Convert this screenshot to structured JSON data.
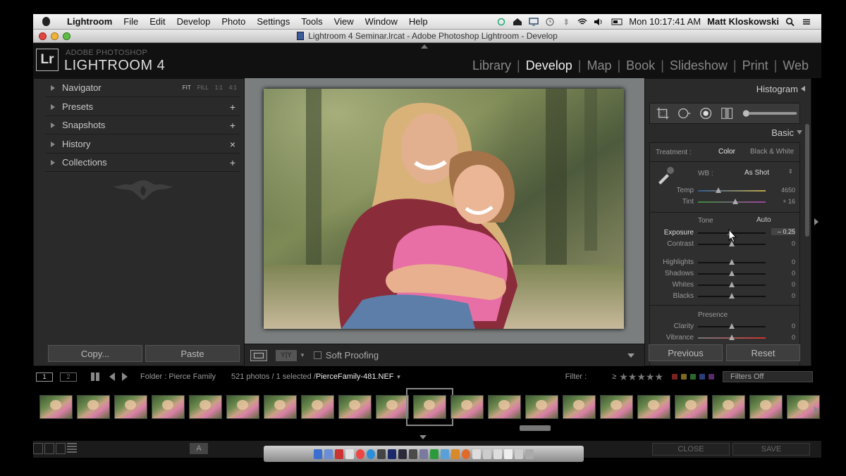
{
  "menubar": {
    "app": "Lightroom",
    "items": [
      "File",
      "Edit",
      "Develop",
      "Photo",
      "Settings",
      "Tools",
      "View",
      "Window",
      "Help"
    ],
    "clock": "Mon 10:17:41 AM",
    "user": "Matt Kloskowski"
  },
  "window": {
    "title": "Lightroom 4 Seminar.lrcat - Adobe Photoshop Lightroom - Develop"
  },
  "header": {
    "logo": "Lr",
    "subtitle": "ADOBE PHOTOSHOP",
    "product": "LIGHTROOM 4",
    "modules": [
      "Library",
      "Develop",
      "Map",
      "Book",
      "Slideshow",
      "Print",
      "Web"
    ],
    "active_module": "Develop"
  },
  "left_panel": {
    "sections": [
      {
        "label": "Navigator",
        "action": ""
      },
      {
        "label": "Presets",
        "action": "+"
      },
      {
        "label": "Snapshots",
        "action": "+"
      },
      {
        "label": "History",
        "action": "×"
      },
      {
        "label": "Collections",
        "action": "+"
      }
    ],
    "zoom_options": [
      "FIT",
      "FILL",
      "1:1",
      "4:1"
    ],
    "copy_label": "Copy...",
    "paste_label": "Paste"
  },
  "toolbar": {
    "view_compare": "Y|Y",
    "soft_proofing": "Soft Proofing"
  },
  "right_panel": {
    "histogram_label": "Histogram",
    "basic_label": "Basic",
    "treatment_label": "Treatment :",
    "treatment_color": "Color",
    "treatment_bw": "Black & White",
    "wb_label": "WB :",
    "wb_value": "As Shot",
    "tone_label": "Tone",
    "auto_label": "Auto",
    "presence_label": "Presence",
    "sliders": [
      {
        "label": "Temp",
        "value": "4650",
        "position": 0.3
      },
      {
        "label": "Tint",
        "value": "+ 16",
        "position": 0.55
      },
      {
        "label": "Exposure",
        "value": "– 0.25",
        "position": 0.48
      },
      {
        "label": "Contrast",
        "value": "0",
        "position": 0.5
      },
      {
        "label": "Highlights",
        "value": "0",
        "position": 0.5
      },
      {
        "label": "Shadows",
        "value": "0",
        "position": 0.5
      },
      {
        "label": "Whites",
        "value": "0",
        "position": 0.5
      },
      {
        "label": "Blacks",
        "value": "0",
        "position": 0.5
      },
      {
        "label": "Clarity",
        "value": "0",
        "position": 0.5
      },
      {
        "label": "Vibrance",
        "value": "0",
        "position": 0.5
      }
    ],
    "previous_label": "Previous",
    "reset_label": "Reset"
  },
  "filmstrip": {
    "screen_1": "1",
    "screen_2": "2",
    "folder": "Folder : Pierce Family",
    "count": "521 photos / 1 selected /",
    "file": "PierceFamily-481.NEF",
    "filter_label": "Filter :",
    "rating_op": "≥",
    "stars": "★★★★★",
    "filters_off": "Filters Off",
    "thumb_count": 21,
    "selected_index": 10
  },
  "bottom": {
    "a_label": "A",
    "close_label": "CLOSE",
    "save_label": "SAVE"
  },
  "colors": {
    "panel": "#2a2a2a",
    "canvas": "#7b7e7e",
    "chrome": "#111111"
  }
}
